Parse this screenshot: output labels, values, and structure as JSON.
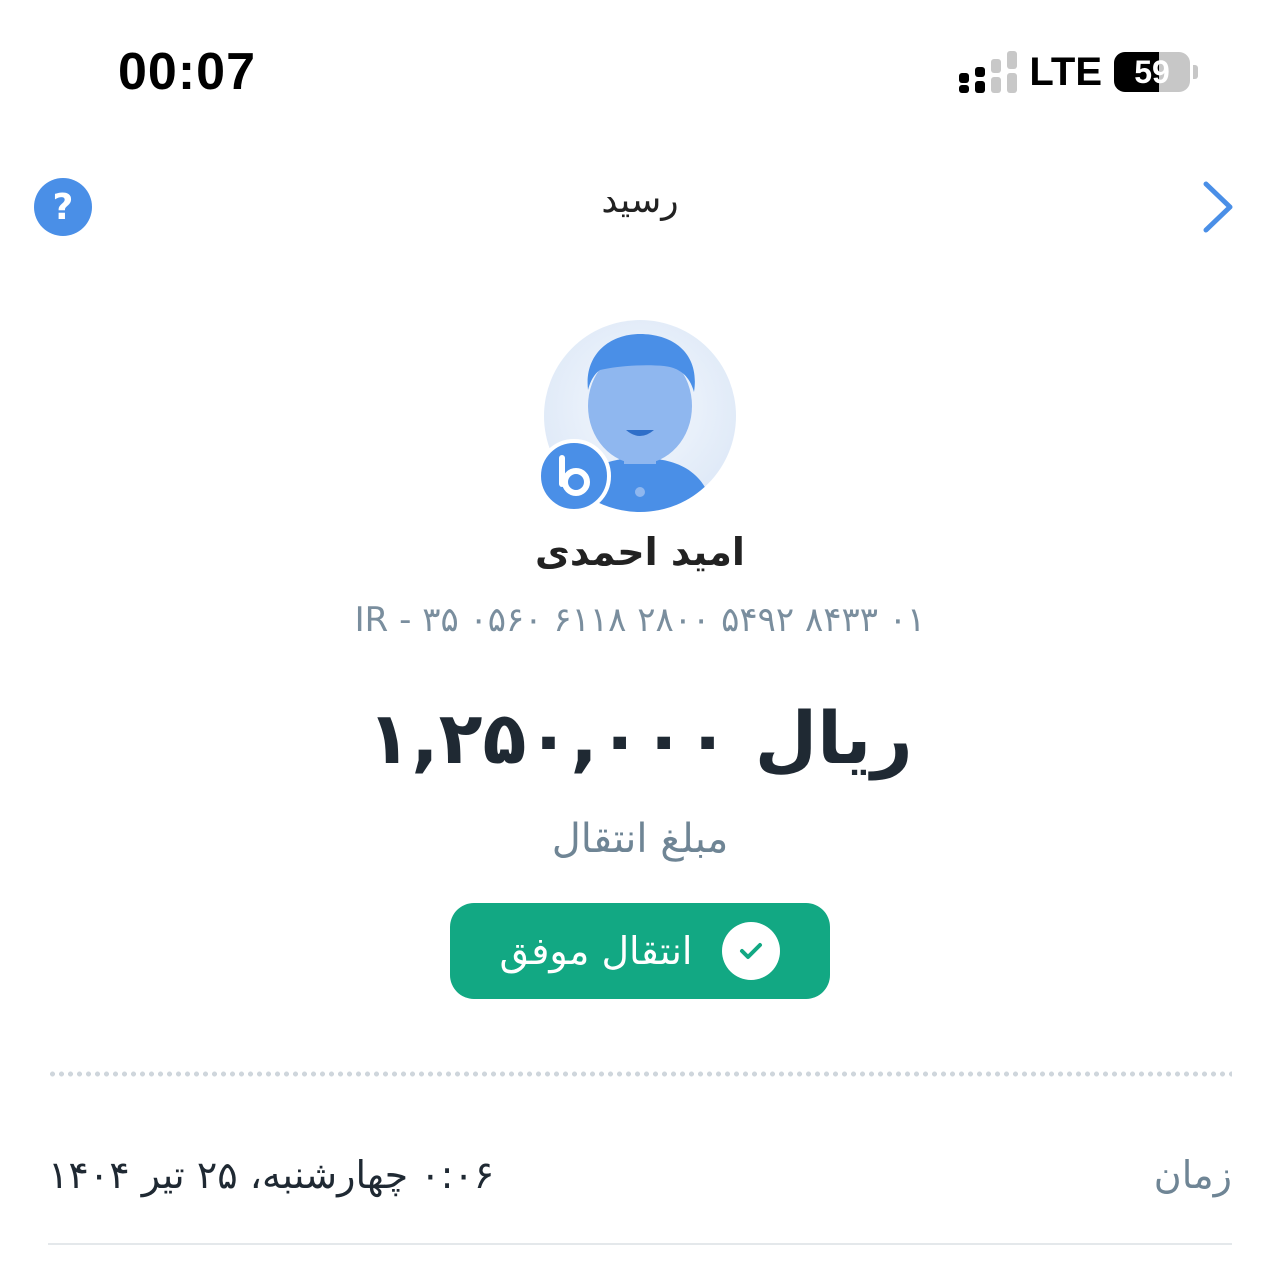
{
  "status_bar": {
    "time": "00:07",
    "network": "LTE",
    "battery_percent": "59",
    "battery_level": 0.59
  },
  "header": {
    "title": "رسید",
    "help_label": "?"
  },
  "recipient": {
    "name": "امید احمدی",
    "account_number": "IR - ۳۵ ۰۵۶۰ ۶۱۱۸ ۲۸۰۰ ۵۴۹۲ ۸۴۳۳ ۰۱"
  },
  "transfer": {
    "amount": "۱,۲۵۰,۰۰۰ ریال",
    "amount_label": "مبلغ انتقال",
    "status_text": "انتقال موفق"
  },
  "details": [
    {
      "label": "زمان",
      "value": "۰:۰۶ چهارشنبه، ۲۵ تیر ۱۴۰۴"
    }
  ],
  "colors": {
    "accent": "#4a8fe7",
    "success": "#12a883",
    "muted_text": "#7a8e9e"
  }
}
